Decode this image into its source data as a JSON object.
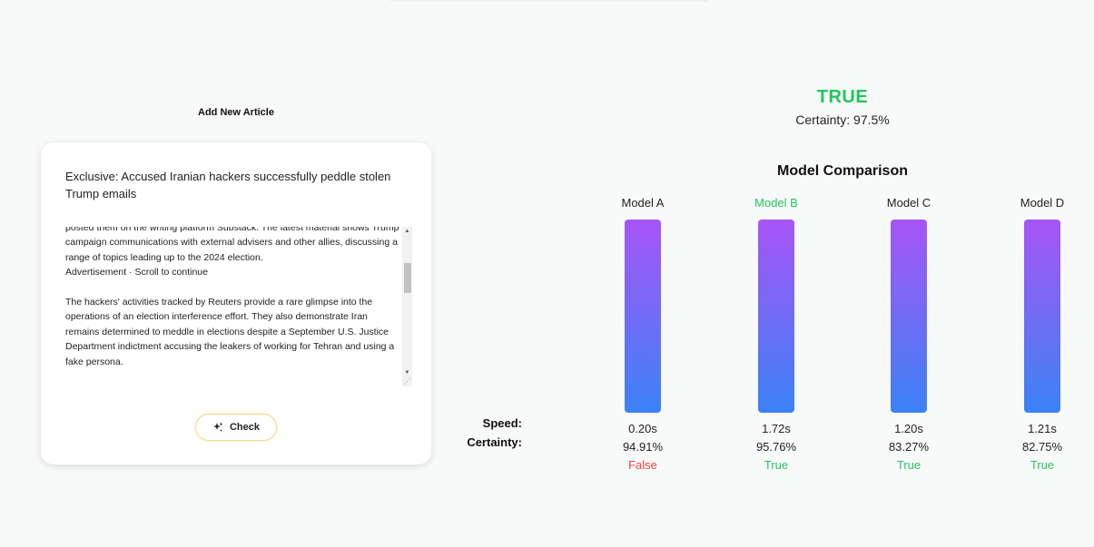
{
  "left_panel": {
    "heading": "Add New Article",
    "article_title": "Exclusive: Accused Iranian hackers successfully peddle stolen Trump emails",
    "article_body": "posted them on the writing platform Substack. The latest material shows Trump campaign communications with external advisers and other allies, discussing a range of topics leading up to the 2024 election.\nAdvertisement · Scroll to continue\n\nThe hackers' activities tracked by Reuters provide a rare glimpse into the operations of an election interference effort. They also demonstrate Iran remains determined to meddle in elections despite a September U.S. Justice Department indictment accusing the leakers of working for Tehran and using a fake persona.",
    "check_button_label": "Check",
    "check_icon": "sparkles-icon"
  },
  "result": {
    "verdict": "TRUE",
    "certainty": "Certainty: 97.5%",
    "comparison_title": "Model Comparison",
    "speed_label": "Speed:",
    "certainty_label": "Certainty:"
  },
  "models": [
    {
      "name": "Model A",
      "speed": "0.20s",
      "certainty": "94.91%",
      "verdict": "False",
      "highlight": false
    },
    {
      "name": "Model B",
      "speed": "1.72s",
      "certainty": "95.76%",
      "verdict": "True",
      "highlight": true
    },
    {
      "name": "Model C",
      "speed": "1.20s",
      "certainty": "83.27%",
      "verdict": "True",
      "highlight": false
    },
    {
      "name": "Model D",
      "speed": "1.21s",
      "certainty": "82.75%",
      "verdict": "True",
      "highlight": false
    }
  ],
  "colors": {
    "true": "#22c55e",
    "false": "#ef4444",
    "bar_top": "#a855f7",
    "bar_bottom": "#3b82f6"
  }
}
